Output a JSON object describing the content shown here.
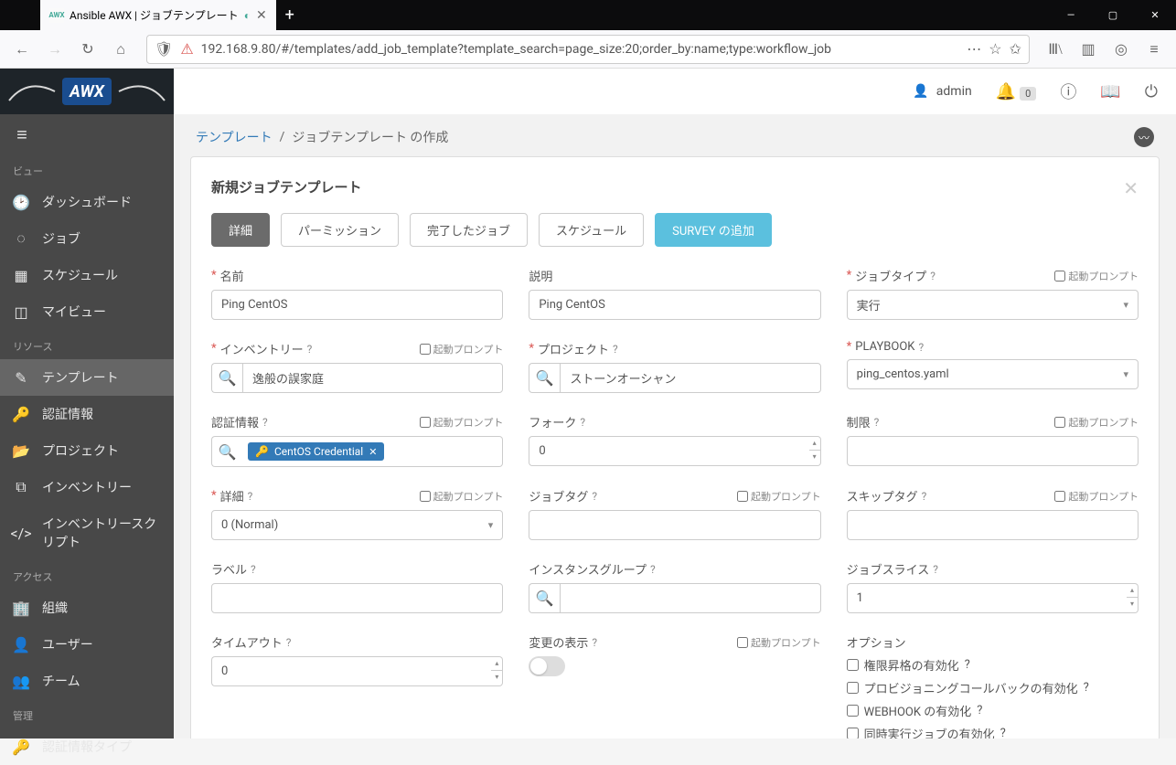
{
  "browser": {
    "tab_title": "Ansible AWX | ジョブテンプレート",
    "favicon": "AWX",
    "url": "192.168.9.80/#/templates/add_job_template?template_search=page_size:20;order_by:name;type:workflow_job"
  },
  "topbar": {
    "user": "admin",
    "notif_count": "0"
  },
  "sidebar": {
    "section_view": "ビュー",
    "section_resource": "リソース",
    "section_access": "アクセス",
    "section_admin": "管理",
    "items": {
      "dashboard": "ダッシュボード",
      "jobs": "ジョブ",
      "schedules": "スケジュール",
      "myview": "マイビュー",
      "templates": "テンプレート",
      "credentials": "認証情報",
      "projects": "プロジェクト",
      "inventories": "インベントリー",
      "inventory_scripts": "インベントリースクリプト",
      "organizations": "組織",
      "users": "ユーザー",
      "teams": "チーム",
      "cred_types": "認証情報タイプ"
    }
  },
  "breadcrumb": {
    "templates": "テンプレート",
    "sep": "/",
    "current": "ジョブテンプレート の作成"
  },
  "panel": {
    "title": "新規ジョブテンプレート",
    "tabs": {
      "details": "詳細",
      "perms": "パーミッション",
      "completed": "完了したジョブ",
      "schedules": "スケジュール",
      "survey": "SURVEY の追加"
    }
  },
  "labels": {
    "name": "名前",
    "desc": "説明",
    "jobtype": "ジョブタイプ",
    "inventory": "インベントリー",
    "project": "プロジェクト",
    "playbook": "PLAYBOOK",
    "credentials": "認証情報",
    "forks": "フォーク",
    "limit": "制限",
    "detail": "詳細",
    "jobtags": "ジョブタグ",
    "skiptags": "スキップタグ",
    "label": "ラベル",
    "instance_groups": "インスタンスグループ",
    "job_slices": "ジョブスライス",
    "timeout": "タイムアウト",
    "showchanges": "変更の表示",
    "options": "オプション",
    "prompt": "起動プロンプト"
  },
  "values": {
    "name": "Ping CentOS",
    "desc": "Ping CentOS",
    "jobtype": "実行",
    "inventory": "逸般の誤家庭",
    "project": "ストーンオーシャン",
    "playbook": "ping_centos.yaml",
    "credential_chip": "CentOS Credential",
    "forks": "0",
    "detail": "0 (Normal)",
    "job_slices": "1",
    "timeout": "0"
  },
  "options": {
    "priv_escalation": "権限昇格の有効化",
    "provisioning": "プロビジョニングコールバックの有効化",
    "webhook": "WEBHOOK の有効化",
    "concurrent": "同時実行ジョブの有効化"
  }
}
